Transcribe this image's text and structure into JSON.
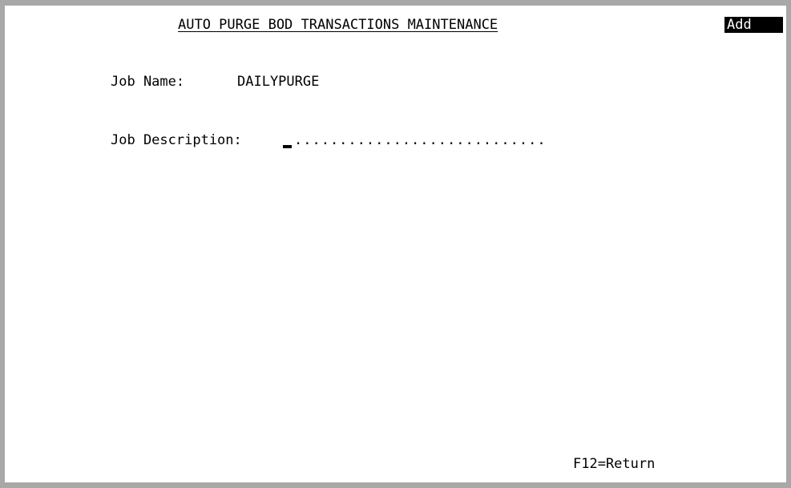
{
  "screen": {
    "title": "AUTO PURGE BOD TRANSACTIONS MAINTENANCE",
    "mode": "Add"
  },
  "form": {
    "job_name_label": "Job Name:",
    "job_name_value": "DAILYPURGE",
    "job_description_label": "Job Description:",
    "job_description_value": "",
    "job_description_fill": "............................"
  },
  "function_keys": {
    "f12": "F12=Return"
  },
  "colors": {
    "background": "#ffffff",
    "frame": "#a8a8a8",
    "text": "#000000",
    "mode_badge_bg": "#000000",
    "mode_badge_text": "#ffffff"
  }
}
